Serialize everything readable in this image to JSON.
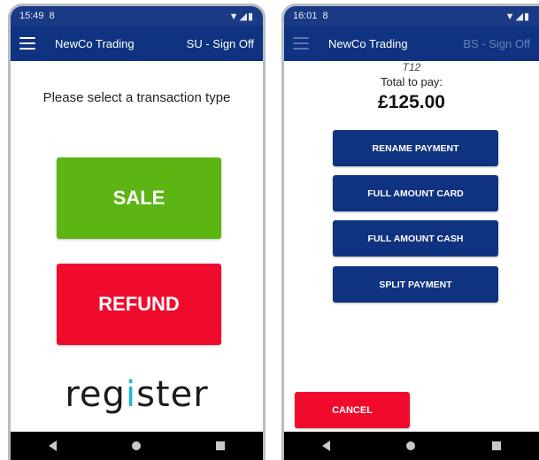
{
  "left_screen": {
    "status": {
      "time": "15:49",
      "sim_icon_glyph": "8",
      "system_icons": "▼◢▮"
    },
    "appbar": {
      "company": "NewCo Trading",
      "signoff": "SU - Sign Off"
    },
    "prompt": "Please select a transaction type",
    "sale_label": "SALE",
    "refund_label": "REFUND",
    "logo": {
      "part1": "reg",
      "dot_part": "i",
      "part2": "ster"
    }
  },
  "right_screen": {
    "status": {
      "time": "16:01",
      "sim_icon_glyph": "8",
      "system_icons": "▼◢▮"
    },
    "appbar": {
      "company": "NewCo Trading",
      "signoff": "BS - Sign Off"
    },
    "ref": "T12",
    "total_label": "Total to pay:",
    "total_amount": "£125.00",
    "buttons": {
      "rename": "RENAME PAYMENT",
      "full_card": "FULL AMOUNT CARD",
      "full_cash": "FULL AMOUNT CASH",
      "split": "SPLIT PAYMENT"
    },
    "cancel_label": "CANCEL"
  },
  "colors": {
    "primary": "#0f3380",
    "sale_green": "#5cb512",
    "refund_red": "#f00a2c",
    "logo_accent": "#1db6d9"
  },
  "icons": [
    "menu-icon",
    "back-icon",
    "home-icon",
    "recent-apps-icon",
    "wifi-icon",
    "signal-icon",
    "battery-icon"
  ]
}
